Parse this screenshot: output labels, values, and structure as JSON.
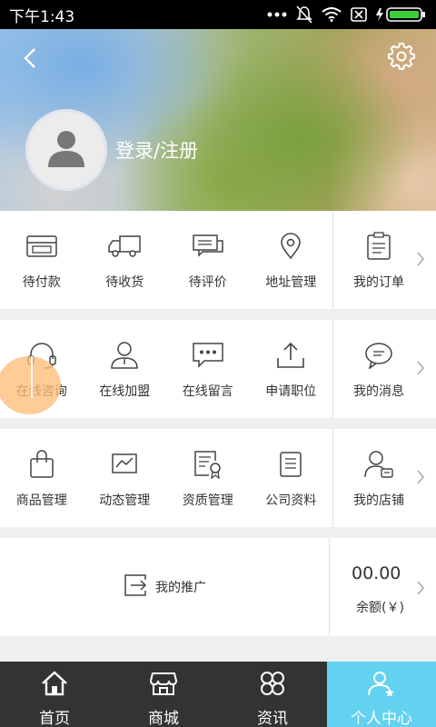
{
  "status_bar": {
    "time": "下午1:43"
  },
  "header": {
    "login_label": "登录/注册"
  },
  "orders": {
    "items": [
      {
        "label": "待付款",
        "icon": "wallet-icon"
      },
      {
        "label": "待收货",
        "icon": "truck-icon"
      },
      {
        "label": "待评价",
        "icon": "chat-icon"
      },
      {
        "label": "地址管理",
        "icon": "location-icon"
      }
    ],
    "side": {
      "label": "我的订单",
      "icon": "clipboard-icon"
    }
  },
  "services": {
    "items": [
      {
        "label": "在线咨询",
        "icon": "headset-icon"
      },
      {
        "label": "在线加盟",
        "icon": "person-icon"
      },
      {
        "label": "在线留言",
        "icon": "message-icon"
      },
      {
        "label": "申请职位",
        "icon": "upload-icon"
      }
    ],
    "side": {
      "label": "我的消息",
      "icon": "speech-bubble-icon"
    }
  },
  "management": {
    "items": [
      {
        "label": "商品管理",
        "icon": "bag-icon"
      },
      {
        "label": "动态管理",
        "icon": "trend-icon"
      },
      {
        "label": "资质管理",
        "icon": "certificate-icon"
      },
      {
        "label": "公司资料",
        "icon": "list-icon"
      }
    ],
    "side": {
      "label": "我的店铺",
      "icon": "user-card-icon"
    }
  },
  "promo": {
    "label": "我的推广",
    "balance_amount": "00.00",
    "balance_label": "余额(￥)"
  },
  "nav": {
    "items": [
      {
        "label": "首页",
        "icon": "home-icon"
      },
      {
        "label": "商城",
        "icon": "store-icon"
      },
      {
        "label": "资讯",
        "icon": "clover-icon"
      },
      {
        "label": "个人中心",
        "icon": "person-star-icon"
      }
    ],
    "active_color": "#63d1f0",
    "bar_color": "#333333"
  }
}
